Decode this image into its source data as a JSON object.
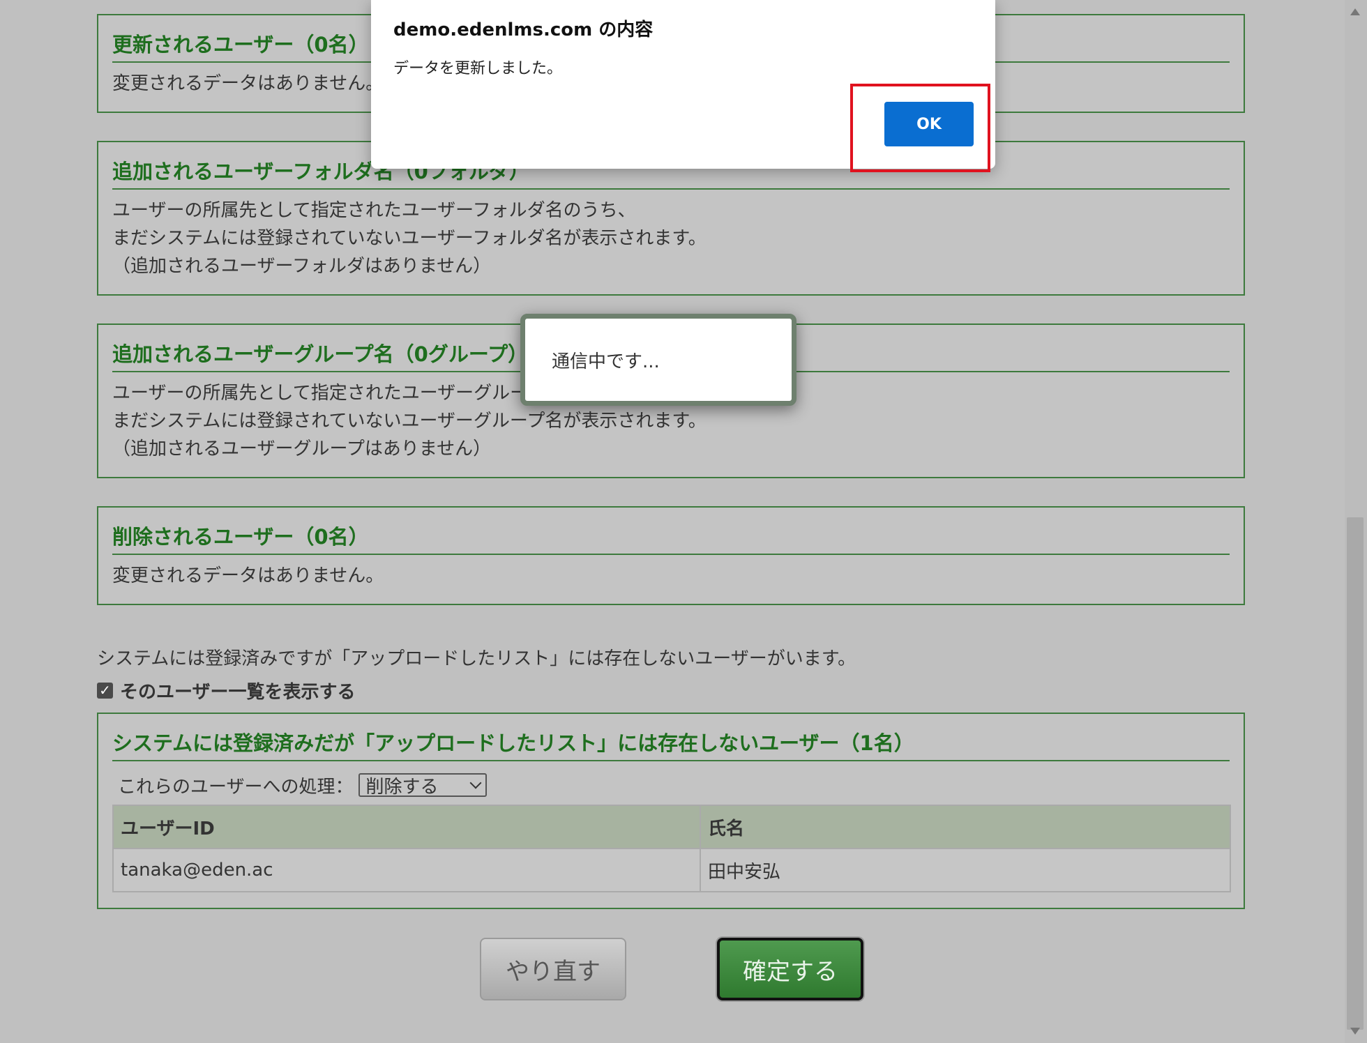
{
  "sections": {
    "updated": {
      "title": "更新されるユーザー（0名）",
      "line1": "変更されるデータはありません。"
    },
    "added_folders": {
      "title": "追加されるユーザーフォルダ名（0フォルダ）",
      "line1": "ユーザーの所属先として指定されたユーザーフォルダ名のうち、",
      "line2": "まだシステムには登録されていないユーザーフォルダ名が表示されます。",
      "line3": "（追加されるユーザーフォルダはありません）"
    },
    "added_groups": {
      "title": "追加されるユーザーグループ名（0グループ）",
      "line1": "ユーザーの所属先として指定されたユーザーグループ名のうち、",
      "line2": "まだシステムには登録されていないユーザーグループ名が表示されます。",
      "line3": "（追加されるユーザーグループはありません）"
    },
    "deleted": {
      "title": "削除されるユーザー（0名）",
      "line1": "変更されるデータはありません。"
    }
  },
  "notice": "システムには登録済みですが「アップロードしたリスト」には存在しないユーザーがいます。",
  "show_list_checkbox": {
    "label": "そのユーザー一覧を表示する",
    "checked": true
  },
  "missing_users": {
    "title": "システムには登録済みだが「アップロードしたリスト」には存在しないユーザー（1名）",
    "process_label": "これらのユーザーへの処理：",
    "process_selected": "削除する",
    "columns": [
      "ユーザーID",
      "氏名"
    ],
    "rows": [
      [
        "tanaka@eden.ac",
        "田中安弘"
      ]
    ]
  },
  "buttons": {
    "redo": "やり直す",
    "confirm": "確定する"
  },
  "loading": {
    "text": "通信中です..."
  },
  "alert": {
    "title": "demo.edenlms.com の内容",
    "message": "データを更新しました。",
    "ok": "OK"
  },
  "colors": {
    "accent_green": "#1e6e1e",
    "panel_border": "#3d7a3d",
    "ok_blue": "#0a6ed1",
    "highlight_red": "#e0121f"
  }
}
